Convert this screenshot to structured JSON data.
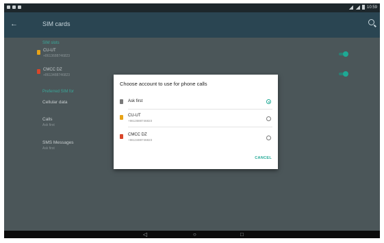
{
  "statusbar": {
    "time": "10:59"
  },
  "appbar": {
    "title": "SIM cards"
  },
  "settings": {
    "sim_section_label": "SIM slots",
    "sims": [
      {
        "name": "CU-UT",
        "number": "+8613688746823",
        "color": "#e8a317",
        "enabled": true
      },
      {
        "name": "CMCC DZ",
        "number": "+8613488746823",
        "color": "#d9462a",
        "enabled": true
      }
    ],
    "prefs_section_label": "Preferred SIM for",
    "prefs": [
      {
        "title": "Cellular data",
        "subtitle": ""
      },
      {
        "title": "Calls",
        "subtitle": "Ask first"
      },
      {
        "title": "SMS Messages",
        "subtitle": "Ask first"
      }
    ]
  },
  "dialog": {
    "title": "Choose account to use for phone calls",
    "options": [
      {
        "name": "Ask first",
        "subtitle": "",
        "icon_color": "#7a7a7a",
        "selected": true
      },
      {
        "name": "CU-UT",
        "subtitle": "+8613688746823",
        "icon_color": "#e8a317",
        "selected": false
      },
      {
        "name": "CMCC DZ",
        "subtitle": "+8613488746823",
        "icon_color": "#d9462a",
        "selected": false
      }
    ],
    "cancel_label": "CANCEL"
  },
  "navbar": {
    "back_icon": "back-triangle-icon",
    "home_icon": "home-circle-icon",
    "recents_icon": "recents-square-icon",
    "back_glyph": "◁",
    "home_glyph": "○",
    "recents_glyph": "□"
  },
  "colors": {
    "accent": "#1ea894",
    "appbar": "#2a4552",
    "dim_background": "#4b5659"
  }
}
